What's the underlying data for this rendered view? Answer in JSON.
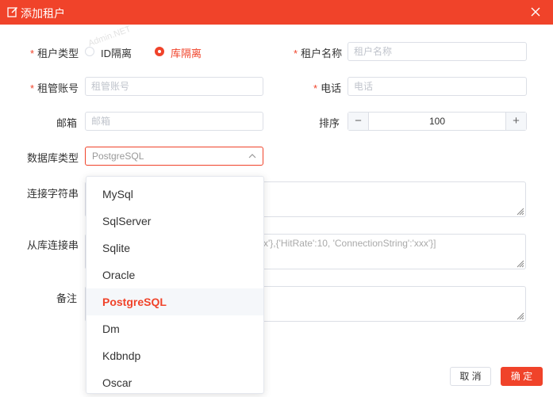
{
  "dialog": {
    "title": "添加租户",
    "close_icon": "close-icon",
    "title_icon": "edit-icon"
  },
  "form": {
    "tenant_type": {
      "label": "租户类型",
      "required_mark": "*",
      "options": [
        {
          "label": "ID隔离",
          "selected": false
        },
        {
          "label": "库隔离",
          "selected": true
        }
      ]
    },
    "tenant_name": {
      "label": "租户名称",
      "required_mark": "*",
      "placeholder": "租户名称"
    },
    "admin_account": {
      "label": "租管账号",
      "required_mark": "*",
      "placeholder": "租管账号"
    },
    "phone": {
      "label": "电话",
      "required_mark": "*",
      "placeholder": "电话"
    },
    "email": {
      "label": "邮箱",
      "placeholder": "邮箱"
    },
    "order": {
      "label": "排序",
      "value": "100",
      "minus": "−",
      "plus": "+"
    },
    "db_type": {
      "label": "数据库类型",
      "value": "PostgreSQL"
    },
    "connection": {
      "label": "连接字符串"
    },
    "slave_connection": {
      "label": "从库连接串",
      "placeholder_visible": "xxx'},{'HitRate':10, 'ConnectionString':'xxx'}]"
    },
    "remark": {
      "label": "备注"
    }
  },
  "dropdown": {
    "options": [
      "MySql",
      "SqlServer",
      "Sqlite",
      "Oracle",
      "PostgreSQL",
      "Dm",
      "Kdbndp",
      "Oscar"
    ],
    "selected": "PostgreSQL"
  },
  "footer": {
    "cancel_label": "取 消",
    "ok_label": "确 定"
  },
  "watermark": "Admin.NET",
  "colors": {
    "accent": "#f0432a",
    "border": "#dcdfe6"
  }
}
